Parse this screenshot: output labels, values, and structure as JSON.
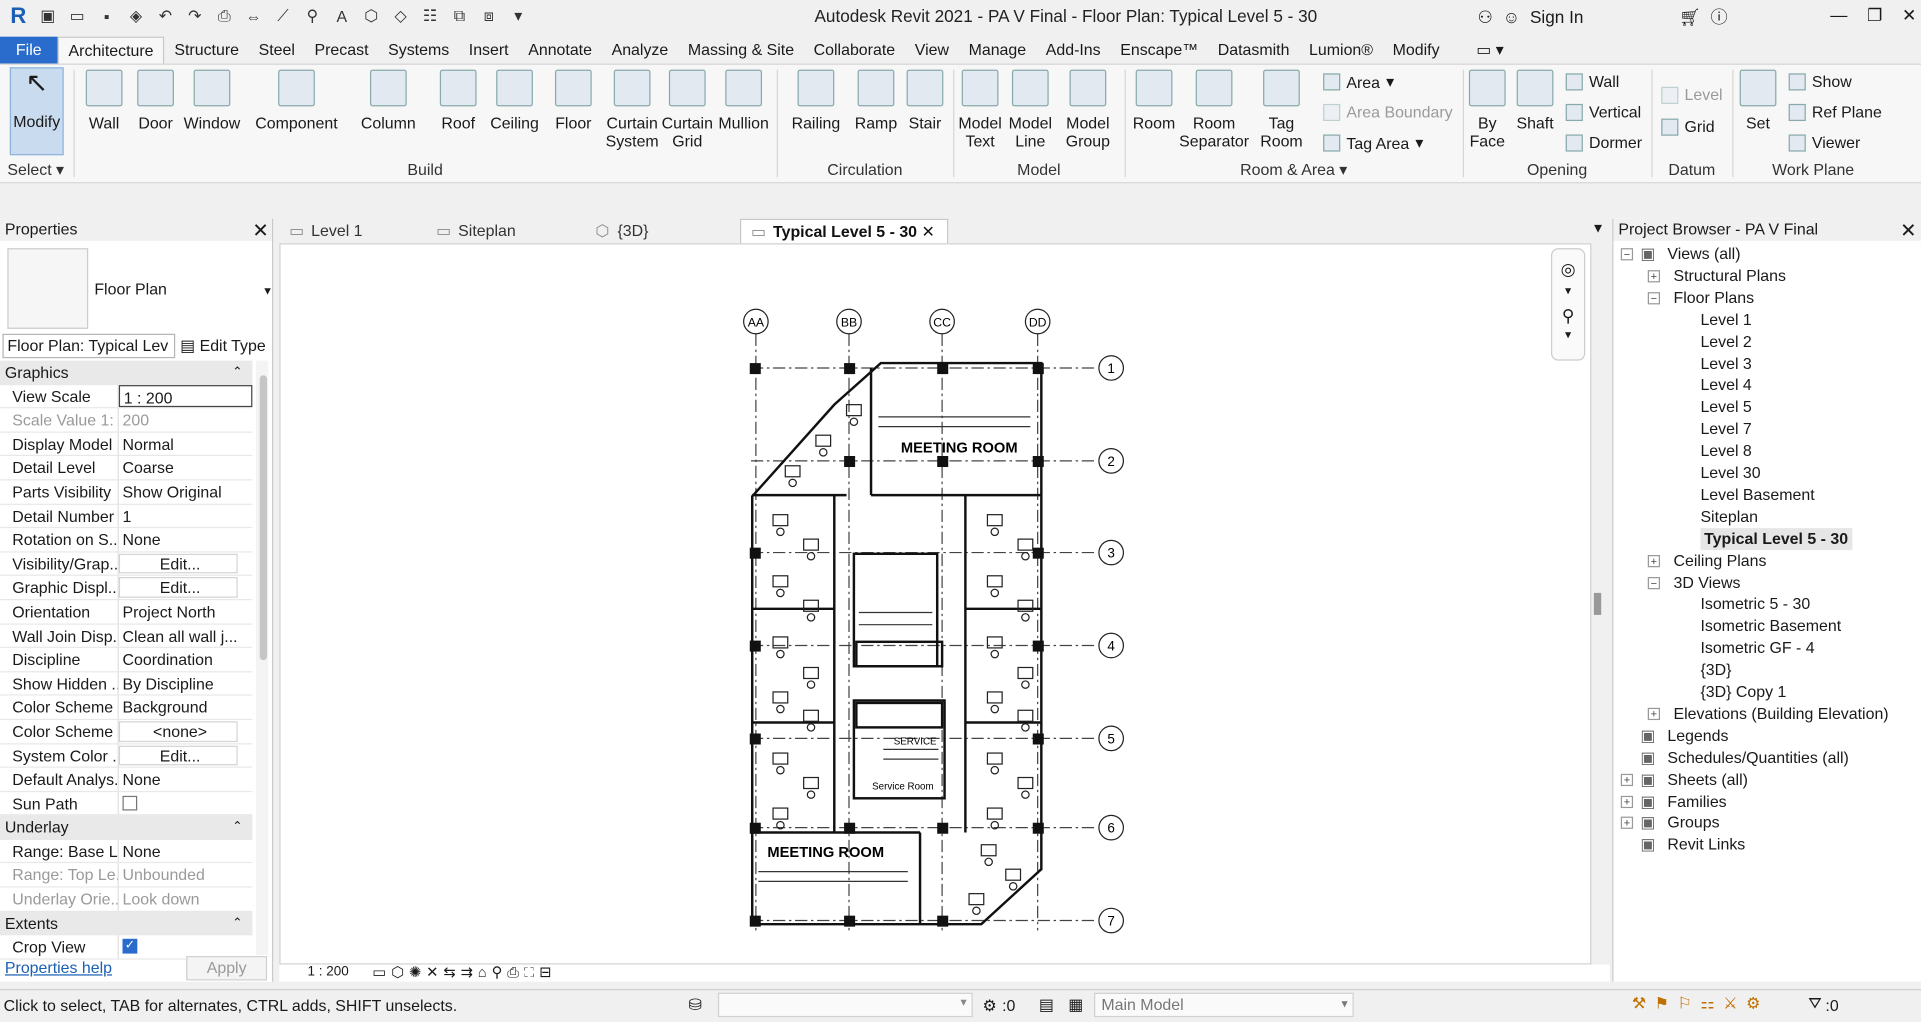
{
  "window": {
    "title": "Autodesk Revit 2021 - PA V Final - Floor Plan: Typical Level 5 - 30",
    "sign_in": "Sign In"
  },
  "menu_tabs": [
    "File",
    "Architecture",
    "Structure",
    "Steel",
    "Precast",
    "Systems",
    "Insert",
    "Annotate",
    "Analyze",
    "Massing & Site",
    "Collaborate",
    "View",
    "Manage",
    "Add-Ins",
    "Enscape™",
    "Datasmith",
    "Lumion®",
    "Modify"
  ],
  "ribbon": {
    "select": {
      "modify": "Modify",
      "select_label": "Select"
    },
    "build": {
      "label": "Build",
      "buttons": [
        "Wall",
        "Door",
        "Window",
        "Component",
        "Column",
        "Roof",
        "Ceiling",
        "Floor",
        "Curtain System",
        "Curtain Grid",
        "Mullion"
      ]
    },
    "circulation": {
      "label": "Circulation",
      "buttons": [
        "Railing",
        "Ramp",
        "Stair"
      ]
    },
    "model": {
      "label": "Model",
      "buttons": [
        "Model Text",
        "Model Line",
        "Model Group"
      ]
    },
    "room_area": {
      "label": "Room & Area",
      "buttons": [
        "Room",
        "Room Separator",
        "Tag Room"
      ],
      "small": [
        "Area",
        "Area Boundary",
        "Tag Area"
      ]
    },
    "opening": {
      "label": "Opening",
      "buttons": [
        "By Face",
        "Shaft"
      ],
      "small": [
        "Wall",
        "Vertical",
        "Dormer"
      ]
    },
    "datum": {
      "label": "Datum",
      "small": [
        "Level",
        "Grid"
      ]
    },
    "work_plane": {
      "label": "Work Plane",
      "buttons": [
        "Set"
      ],
      "small": [
        "Show",
        "Ref Plane",
        "Viewer"
      ]
    }
  },
  "properties": {
    "title": "Properties",
    "type_name": "Floor Plan",
    "instance": "Floor Plan: Typical Lev",
    "edit_type": "Edit Type",
    "rows": [
      {
        "cat": "Graphics"
      },
      {
        "k": "View Scale",
        "v": "1 : 200"
      },
      {
        "k": "Scale Value    1:",
        "v": "200",
        "dim": true
      },
      {
        "k": "Display Model",
        "v": "Normal"
      },
      {
        "k": "Detail Level",
        "v": "Coarse"
      },
      {
        "k": "Parts Visibility",
        "v": "Show Original"
      },
      {
        "k": "Detail Number",
        "v": "1"
      },
      {
        "k": "Rotation on S...",
        "v": "None"
      },
      {
        "k": "Visibility/Grap...",
        "v": "Edit...",
        "btn": true
      },
      {
        "k": "Graphic Displ...",
        "v": "Edit...",
        "btn": true
      },
      {
        "k": "Orientation",
        "v": "Project North"
      },
      {
        "k": "Wall Join Disp...",
        "v": "Clean all wall j..."
      },
      {
        "k": "Discipline",
        "v": "Coordination"
      },
      {
        "k": "Show Hidden ...",
        "v": "By Discipline"
      },
      {
        "k": "Color Scheme ...",
        "v": "Background"
      },
      {
        "k": "Color Scheme",
        "v": "<none>",
        "btn": true
      },
      {
        "k": "System Color ...",
        "v": "Edit...",
        "btn": true
      },
      {
        "k": "Default Analys...",
        "v": "None"
      },
      {
        "k": "Sun Path",
        "check": false
      },
      {
        "cat": "Underlay"
      },
      {
        "k": "Range: Base L...",
        "v": "None"
      },
      {
        "k": "Range: Top Le...",
        "v": "Unbounded",
        "dim": true
      },
      {
        "k": "Underlay Orie...",
        "v": "Look down",
        "dim": true
      },
      {
        "cat": "Extents"
      },
      {
        "k": "Crop View",
        "check": true
      }
    ],
    "help": "Properties help",
    "apply": "Apply"
  },
  "view_tabs": [
    {
      "label": "Level 1"
    },
    {
      "label": "Siteplan"
    },
    {
      "label": "{3D}"
    },
    {
      "label": "Typical Level 5 - 30",
      "active": true
    }
  ],
  "plan": {
    "grid_cols": [
      "AA",
      "BB",
      "CC",
      "DD"
    ],
    "grid_rows": [
      "1",
      "2",
      "3",
      "4",
      "5",
      "6",
      "7"
    ],
    "rooms": [
      "MEETING ROOM",
      "MEETING ROOM",
      "SERVICE",
      "Service Room"
    ],
    "scale": "1 : 200"
  },
  "browser": {
    "title": "Project Browser - PA V Final",
    "items": [
      {
        "label": "Views (all)",
        "lvl": 0,
        "exp": "-"
      },
      {
        "label": "Structural Plans",
        "lvl": 1,
        "exp": "+"
      },
      {
        "label": "Floor Plans",
        "lvl": 1,
        "exp": "-"
      },
      {
        "label": "Level 1",
        "lvl": 2
      },
      {
        "label": "Level 2",
        "lvl": 2
      },
      {
        "label": "Level 3",
        "lvl": 2
      },
      {
        "label": "Level 4",
        "lvl": 2
      },
      {
        "label": "Level 5",
        "lvl": 2
      },
      {
        "label": "Level 7",
        "lvl": 2
      },
      {
        "label": "Level 8",
        "lvl": 2
      },
      {
        "label": "Level 30",
        "lvl": 2
      },
      {
        "label": "Level Basement",
        "lvl": 2
      },
      {
        "label": "Siteplan",
        "lvl": 2
      },
      {
        "label": "Typical Level 5 - 30",
        "lvl": 2,
        "sel": true
      },
      {
        "label": "Ceiling Plans",
        "lvl": 1,
        "exp": "+"
      },
      {
        "label": "3D Views",
        "lvl": 1,
        "exp": "-"
      },
      {
        "label": "Isometric 5 - 30",
        "lvl": 2
      },
      {
        "label": "Isometric Basement",
        "lvl": 2
      },
      {
        "label": "Isometric GF - 4",
        "lvl": 2
      },
      {
        "label": "{3D}",
        "lvl": 2
      },
      {
        "label": "{3D} Copy 1",
        "lvl": 2
      },
      {
        "label": "Elevations (Building Elevation)",
        "lvl": 1,
        "exp": "+"
      },
      {
        "label": "Legends",
        "lvl": 0
      },
      {
        "label": "Schedules/Quantities (all)",
        "lvl": 0
      },
      {
        "label": "Sheets (all)",
        "lvl": 0,
        "exp": "+"
      },
      {
        "label": "Families",
        "lvl": 0,
        "exp": "+"
      },
      {
        "label": "Groups",
        "lvl": 0,
        "exp": "+"
      },
      {
        "label": "Revit Links",
        "lvl": 0
      }
    ]
  },
  "status": {
    "hint": "Click to select, TAB for alternates, CTRL adds, SHIFT unselects.",
    "zero1": ":0",
    "model": "Main Model",
    "filter_count": ":0"
  }
}
